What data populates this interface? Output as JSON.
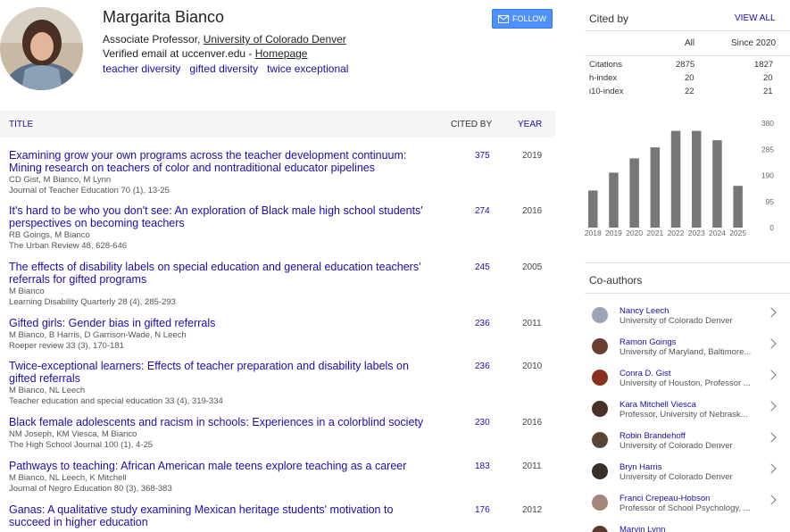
{
  "profile": {
    "name": "Margarita Bianco",
    "position": "Associate Professor, ",
    "affiliation": "University of Colorado Denver",
    "email": "Verified email at uccenver.edu - ",
    "homepage": "Homepage",
    "interests": [
      "teacher diversity",
      "gifted diversity",
      "twice exceptional"
    ],
    "follow_label": "FOLLOW"
  },
  "table": {
    "col_title": "TITLE",
    "col_cited": "CITED BY",
    "col_year": "YEAR"
  },
  "articles": [
    {
      "title": "Examining grow your own programs across the teacher development continuum: Mining research on teachers of color and nontraditional educator pipelines",
      "authors": "CD Gist, M Bianco, M Lynn",
      "journal": "Journal of Teacher Education 70 (1), 13-25",
      "cites": "375",
      "year": "2019"
    },
    {
      "title": "It's hard to be who you don't see: An exploration of Black male high school students' perspectives on becoming teachers",
      "authors": "RB Goings, M Bianco",
      "journal": "The Urban Review 48, 628-646",
      "cites": "274",
      "year": "2016"
    },
    {
      "title": "The effects of disability labels on special education and general education teachers' referrals for gifted programs",
      "authors": "M Bianco",
      "journal": "Learning Disability Quarterly 28 (4), 285-293",
      "cites": "245",
      "year": "2005"
    },
    {
      "title": "Gifted girls: Gender bias in gifted referrals",
      "authors": "M Bianco, B Harris, D Garrison-Wade, N Leech",
      "journal": "Roeper review 33 (3), 170-181",
      "cites": "236",
      "year": "2011"
    },
    {
      "title": "Twice-exceptional learners: Effects of teacher preparation and disability labels on gifted referrals",
      "authors": "M Bianco, NL Leech",
      "journal": "Teacher education and special education 33 (4), 319-334",
      "cites": "236",
      "year": "2010"
    },
    {
      "title": "Black female adolescents and racism in schools: Experiences in a colorblind society",
      "authors": "NM Joseph, KM Viesca, M Bianco",
      "journal": "The High School Journal 100 (1), 4-25",
      "cites": "230",
      "year": "2016"
    },
    {
      "title": "Pathways to teaching: African American male teens explore teaching as a career",
      "authors": "M Bianco, NL Leech, K Mitchell",
      "journal": "Journal of Negro Education 80 (3), 368-383",
      "cites": "183",
      "year": "2011"
    },
    {
      "title": "Ganas: A qualitative study examining Mexican heritage students' motivation to succeed in higher education",
      "authors": "",
      "journal": "",
      "cites": "176",
      "year": "2012"
    }
  ],
  "cited_by": {
    "heading": "Cited by",
    "view_all": "VIEW ALL",
    "col_all": "All",
    "col_since": "Since 2020",
    "rows": [
      {
        "label": "Citations",
        "all": "2875",
        "since": "1827"
      },
      {
        "label": "h-index",
        "all": "20",
        "since": "20"
      },
      {
        "label": "i10-index",
        "all": "22",
        "since": "21"
      }
    ]
  },
  "chart_data": {
    "type": "bar",
    "categories": [
      "2018",
      "2019",
      "2020",
      "2021",
      "2022",
      "2023",
      "2024",
      "2025"
    ],
    "values": [
      135,
      200,
      252,
      292,
      352,
      352,
      318,
      152
    ],
    "ylim": [
      0,
      380
    ],
    "yticks": [
      "380",
      "285",
      "190",
      "95",
      "0"
    ],
    "color": "#777777"
  },
  "coauthors_section": {
    "heading": "Co-authors",
    "items": [
      {
        "name": "Nancy Leech",
        "affiliation": "University of Colorado Denver",
        "color": "#9aa6b5"
      },
      {
        "name": "Ramon Goings",
        "affiliation": "University of Maryland, Baltimore...",
        "color": "#6b3f2f"
      },
      {
        "name": "Conra D. Gist",
        "affiliation": "University of Houston, Professor ...",
        "color": "#8a3020"
      },
      {
        "name": "Kara Mitchell Viesca",
        "affiliation": "Professor, University of Nebrask...",
        "color": "#4a3028"
      },
      {
        "name": "Robin Brandehoff",
        "affiliation": "University of Colorado Denver",
        "color": "#5a4535"
      },
      {
        "name": "Bryn Harris",
        "affiliation": "University of Colorado Denver",
        "color": "#3c2e2a"
      },
      {
        "name": "Franci Crepeau-Hobson",
        "affiliation": "Professor of School Psychology, ...",
        "color": "#a8857a"
      },
      {
        "name": "Marvin Lynn",
        "affiliation": "",
        "color": "#5a3a30"
      }
    ]
  }
}
